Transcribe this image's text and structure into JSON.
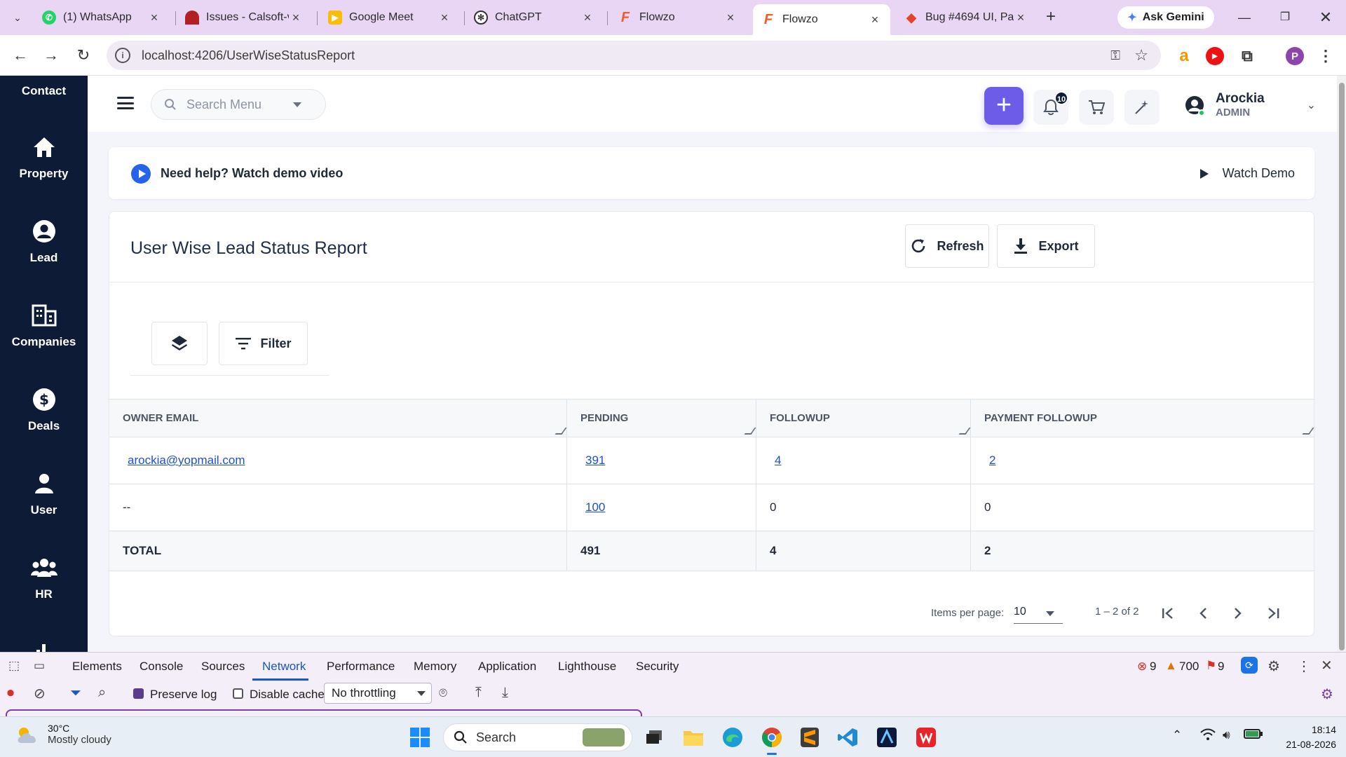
{
  "browser": {
    "tabs": [
      {
        "title": "(1) WhatsApp",
        "favicon": "whatsapp-icon",
        "color": "#25d366"
      },
      {
        "title": "Issues - Calsoft-v",
        "favicon": "redmine-icon",
        "color": "#b32024"
      },
      {
        "title": "Google Meet",
        "favicon": "meet-icon",
        "color": "#00832d"
      },
      {
        "title": "ChatGPT",
        "favicon": "chatgpt-icon",
        "color": "#202124"
      },
      {
        "title": "Flowzo",
        "favicon": "flowzo-icon",
        "color": "#f25c2a"
      },
      {
        "title": "Flowzo",
        "favicon": "flowzo-icon",
        "color": "#f25c2a",
        "active": true
      },
      {
        "title": "Bug #4694 UI, Pa",
        "favicon": "gitlab-icon",
        "color": "#e24329"
      }
    ],
    "ask_gemini": "Ask Gemini",
    "url": "localhost:4206/UserWiseStatusReport",
    "profile_initial": "P",
    "extensions": [
      "amazon-icon",
      "youtube-icon",
      "puzzle-icon"
    ]
  },
  "sidebar": {
    "items": [
      {
        "label": "Contact",
        "icon": "contact-icon"
      },
      {
        "label": "Property",
        "icon": "home-icon"
      },
      {
        "label": "Lead",
        "icon": "user-circle-icon"
      },
      {
        "label": "Companies",
        "icon": "building-icon"
      },
      {
        "label": "Deals",
        "icon": "dollar-icon"
      },
      {
        "label": "User",
        "icon": "user-icon"
      },
      {
        "label": "HR",
        "icon": "team-icon"
      }
    ],
    "bg_color": "#0d1b36"
  },
  "topbar": {
    "search_placeholder": "Search Menu",
    "notification_count": "10",
    "user_name": "Arockia",
    "user_role": "ADMIN",
    "accent_color": "#6c5ce7"
  },
  "help": {
    "text": "Need help? Watch demo video",
    "watch_demo": "Watch Demo"
  },
  "report": {
    "title": "User Wise Lead Status Report",
    "refresh_label": "Refresh",
    "export_label": "Export",
    "filter_label": "Filter",
    "columns": [
      "OWNER EMAIL",
      "PENDING",
      "FOLLOWUP",
      "PAYMENT FOLLOWUP"
    ],
    "rows": [
      {
        "owner": "arockia@yopmail.com",
        "pending": "391",
        "followup": "4",
        "payment": "2"
      },
      {
        "owner": "--",
        "pending": "100",
        "followup": "0",
        "payment": "0"
      }
    ],
    "total": {
      "label": "TOTAL",
      "pending": "491",
      "followup": "4",
      "payment": "2"
    },
    "pager": {
      "items_per_page_label": "Items per page:",
      "items_per_page": "10",
      "range": "1 – 2 of 2"
    }
  },
  "devtools": {
    "tabs": [
      "Elements",
      "Console",
      "Sources",
      "Network",
      "Performance",
      "Memory",
      "Application",
      "Lighthouse",
      "Security"
    ],
    "active_tab": "Network",
    "errors": "9",
    "warnings": "700",
    "issues": "9",
    "preserve_log": "Preserve log",
    "disable_cache": "Disable cache",
    "throttling": "No throttling"
  },
  "taskbar": {
    "temperature": "30°C",
    "weather": "Mostly cloudy",
    "search": "Search",
    "time": "18:14",
    "date": "21-08-2026"
  }
}
